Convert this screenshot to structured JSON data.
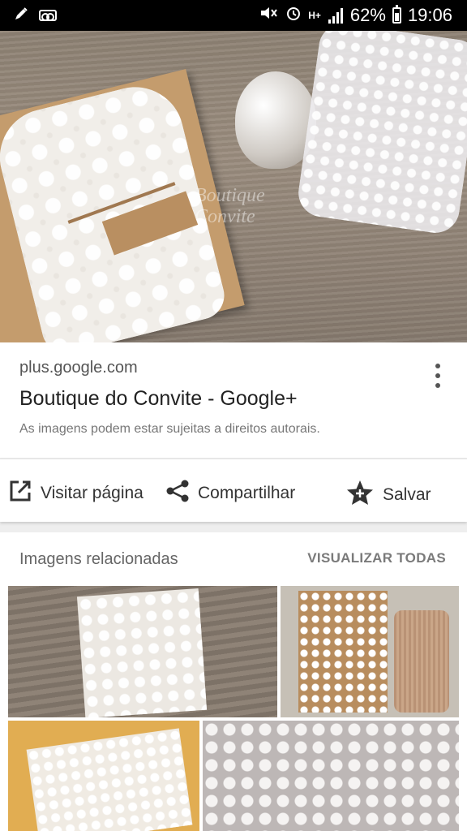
{
  "status_bar": {
    "battery_percent": "62%",
    "time": "19:06",
    "network_label": "H+",
    "icons": [
      "edit-pen-icon",
      "voicemail-icon",
      "mute-icon",
      "alarm-icon",
      "network-icon",
      "signal-icon",
      "battery-icon"
    ]
  },
  "hero": {
    "watermark": "Boutique\nConvite"
  },
  "result": {
    "domain": "plus.google.com",
    "title": "Boutique do Convite - Google+",
    "copyright": "As imagens podem estar sujeitas a direitos autorais."
  },
  "actions": {
    "visit_label": "Visitar página",
    "share_label": "Compartilhar",
    "save_label": "Salvar"
  },
  "related": {
    "heading": "Imagens relacionadas",
    "view_all": "VISUALIZAR TODAS"
  },
  "colors": {
    "text_primary": "#222222",
    "text_secondary": "#777777",
    "status_bar": "#000000"
  }
}
